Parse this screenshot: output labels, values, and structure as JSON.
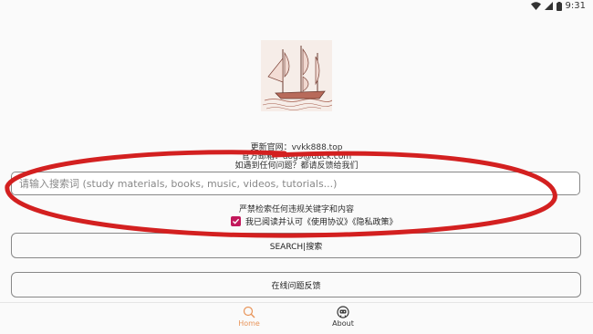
{
  "status_bar": {
    "time": "9:31"
  },
  "logo": {
    "description": "sailing-ship-logo"
  },
  "info": {
    "line1": "更新官网：vvkk888.top",
    "line2": "官方邮箱：dog9@duck.com",
    "line3": "如遇到任何问题？都请反馈给我们"
  },
  "search": {
    "placeholder": "请输入搜索词 (study materials, books, music, videos, tutorials...)"
  },
  "warning": "严禁检索任何违规关键字和内容",
  "agreement": {
    "label": "我已阅读并认可《使用协议》《隐私政策》",
    "checked": true
  },
  "buttons": {
    "search": "SEARCH|搜索",
    "feedback": "在线问题反馈"
  },
  "nav": [
    {
      "label": "Home",
      "active": true
    },
    {
      "label": "About",
      "active": false
    }
  ],
  "colors": {
    "accent": "#e8955a",
    "checkbox": "#c2185b",
    "annotation": "#d32020"
  }
}
